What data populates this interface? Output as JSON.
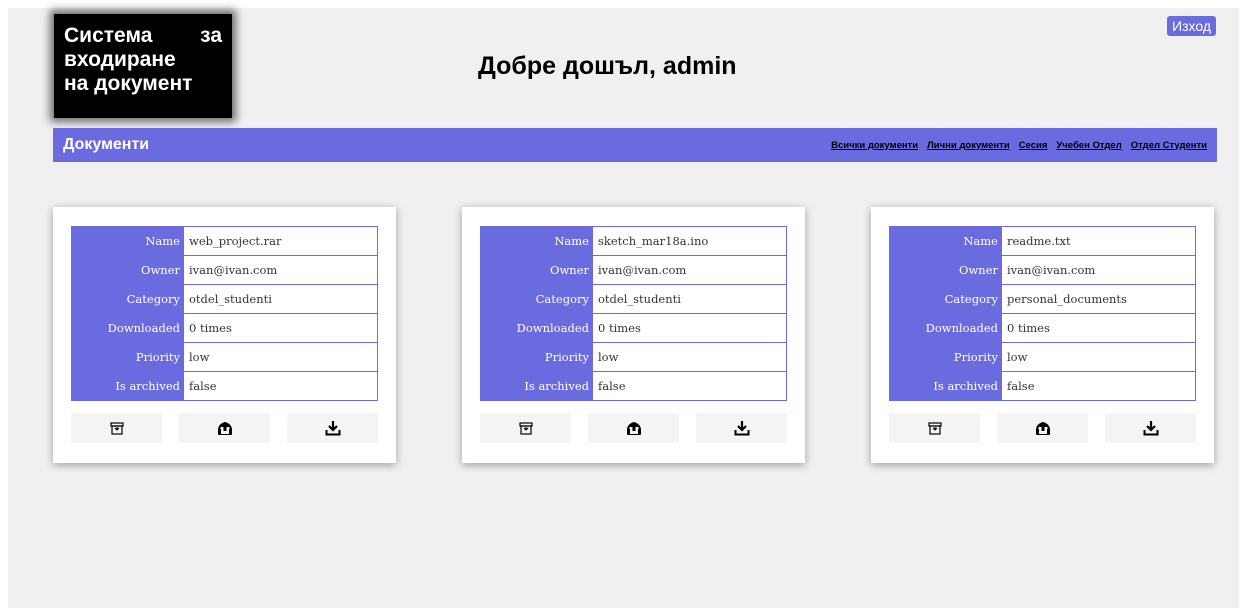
{
  "header": {
    "logo_line1_a": "Система",
    "logo_line1_b": "за",
    "logo_line2": "входиране",
    "logo_line3": "на документ",
    "welcome": "Добре дошъл, admin",
    "logout_label": "Изход"
  },
  "navbar": {
    "title": "Документи",
    "links": [
      "Всички документи",
      "Лични документи",
      "Сесия",
      "Учебен Отдел",
      "Отдел Студенти"
    ]
  },
  "labels": {
    "name": "Name",
    "owner": "Owner",
    "category": "Category",
    "downloaded": "Downloaded",
    "priority": "Priority",
    "archived": "Is archived"
  },
  "documents": [
    {
      "name": "web_project.rar",
      "owner": "ivan@ivan.com",
      "category": "otdel_studenti",
      "downloaded": "0 times",
      "priority": "low",
      "archived": "false"
    },
    {
      "name": "sketch_mar18a.ino",
      "owner": "ivan@ivan.com",
      "category": "otdel_studenti",
      "downloaded": "0 times",
      "priority": "low",
      "archived": "false"
    },
    {
      "name": "readme.txt",
      "owner": "ivan@ivan.com",
      "category": "personal_documents",
      "downloaded": "0 times",
      "priority": "low",
      "archived": "false"
    }
  ],
  "icons": {
    "archive": "archive-icon",
    "upload": "upload-icon",
    "download": "download-icon"
  },
  "colors": {
    "accent": "#6b6be0",
    "background": "#f0f0f0"
  }
}
